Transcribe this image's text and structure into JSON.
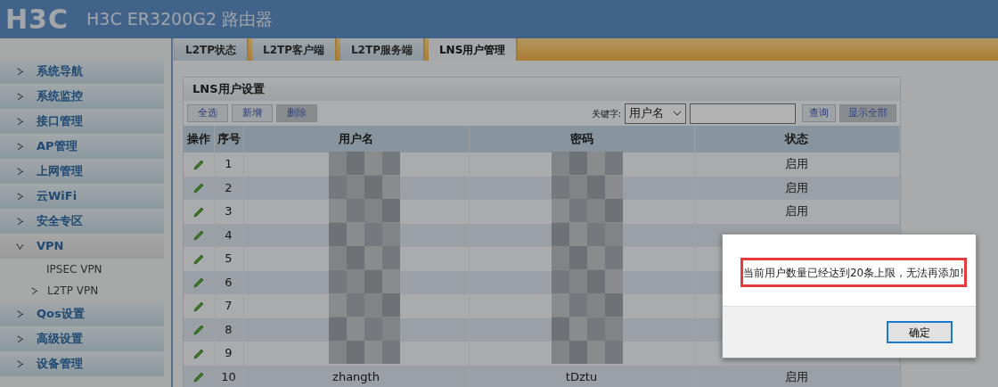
{
  "header": {
    "logo": "H3C",
    "title": "H3C ER3200G2 路由器"
  },
  "sidebar": {
    "items": [
      {
        "label": "系统导航",
        "expanded": false
      },
      {
        "label": "系统监控",
        "expanded": false
      },
      {
        "label": "接口管理",
        "expanded": false
      },
      {
        "label": "AP管理",
        "expanded": false
      },
      {
        "label": "上网管理",
        "expanded": false
      },
      {
        "label": "云WiFi",
        "expanded": false
      },
      {
        "label": "安全专区",
        "expanded": false
      },
      {
        "label": "VPN",
        "expanded": true,
        "children": [
          {
            "label": "IPSEC VPN",
            "selected": false
          },
          {
            "label": "L2TP VPN",
            "selected": true
          }
        ]
      },
      {
        "label": "Qos设置",
        "expanded": false
      },
      {
        "label": "高级设置",
        "expanded": false
      },
      {
        "label": "设备管理",
        "expanded": false
      }
    ]
  },
  "tabs": [
    {
      "label": "L2TP状态",
      "selected": false
    },
    {
      "label": "L2TP客户端",
      "selected": false
    },
    {
      "label": "L2TP服务端",
      "selected": false
    },
    {
      "label": "LNS用户管理",
      "selected": true
    }
  ],
  "panel": {
    "title": "LNS用户设置",
    "toolbar": [
      {
        "label": "全选",
        "disabled": false
      },
      {
        "label": "新增",
        "disabled": false
      },
      {
        "label": "删除",
        "disabled": true
      }
    ],
    "search": {
      "label": "关键字:",
      "field": "用户名",
      "buttons": [
        {
          "label": "查询",
          "disabled": false
        },
        {
          "label": "显示全部",
          "disabled": true
        }
      ]
    },
    "table": {
      "columns": [
        "操作",
        "序号",
        "用户名",
        "密码",
        "状态"
      ],
      "rows": [
        {
          "index": "1",
          "status": "启用"
        },
        {
          "index": "2",
          "status": "启用"
        },
        {
          "index": "3",
          "status": "启用"
        },
        {
          "index": "4"
        },
        {
          "index": "5"
        },
        {
          "index": "6"
        },
        {
          "index": "7"
        },
        {
          "index": "8"
        },
        {
          "index": "9"
        },
        {
          "index": "10",
          "username": "zhangth",
          "password": "tDztu",
          "status": "启用"
        }
      ]
    }
  },
  "dialog": {
    "message": "当前用户数量已经达到20条上限，无法再添加!",
    "button": "确定"
  }
}
